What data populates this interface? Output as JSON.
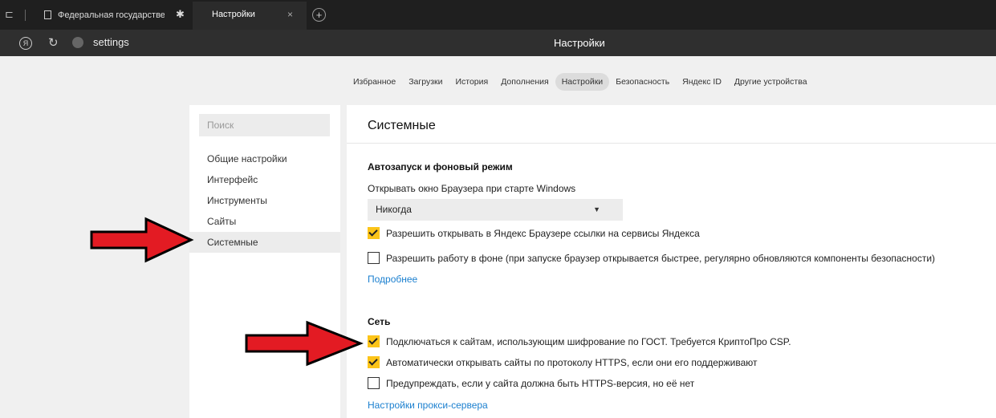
{
  "tabs": {
    "tab1_title": "Федеральная государстве",
    "tab2_title": "Настройки",
    "close_glyph": "×",
    "new_tab_glyph": "+"
  },
  "address": {
    "url": "settings",
    "page_title": "Настройки"
  },
  "topnav": {
    "items": [
      "Избранное",
      "Загрузки",
      "История",
      "Дополнения",
      "Настройки",
      "Безопасность",
      "Яндекс ID",
      "Другие устройства"
    ],
    "active_index": 4
  },
  "sidebar": {
    "search_placeholder": "Поиск",
    "items": [
      "Общие настройки",
      "Интерфейс",
      "Инструменты",
      "Сайты",
      "Системные"
    ],
    "active_index": 4
  },
  "main": {
    "title": "Системные",
    "autostart": {
      "heading": "Автозапуск и фоновый режим",
      "label": "Открывать окно Браузера при старте Windows",
      "select_value": "Никогда",
      "allow_links_label": "Разрешить открывать в Яндекс Браузере ссылки на сервисы Яндекса",
      "allow_links_checked": true,
      "background_label": "Разрешить работу в фоне (при запуске браузер открывается быстрее, регулярно обновляются компоненты безопасности)",
      "background_checked": false,
      "more_link": "Подробнее"
    },
    "network": {
      "heading": "Сеть",
      "gost_label": "Подключаться к сайтам, использующим шифрование по ГОСТ. Требуется КриптоПро CSP.",
      "gost_checked": true,
      "https_label": "Автоматически открывать сайты по протоколу HTTPS, если они его поддерживают",
      "https_checked": true,
      "warn_label": "Предупреждать, если у сайта должна быть HTTPS-версия, но её нет",
      "warn_checked": false,
      "proxy_link": "Настройки прокси-сервера"
    }
  },
  "colors": {
    "checkbox_accent": "#fcc419",
    "link": "#1a7fcf",
    "annotation_arrow": "#e31b23"
  }
}
